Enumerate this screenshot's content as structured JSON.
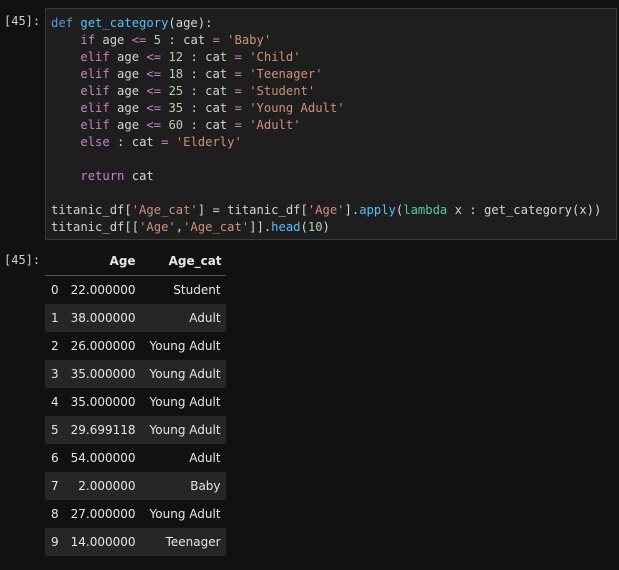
{
  "input_prompt": "[45]:",
  "output_prompt": "[45]:",
  "code": {
    "l1": {
      "def": "def",
      "name": "get_category",
      "args": "(age):"
    },
    "cond_lines": [
      {
        "kw": "if",
        "val": "5",
        "str": "'Baby'"
      },
      {
        "kw": "elif",
        "val": "12",
        "str": "'Child'"
      },
      {
        "kw": "elif",
        "val": "18",
        "str": "'Teenager'"
      },
      {
        "kw": "elif",
        "val": "25",
        "str": "'Student'"
      },
      {
        "kw": "elif",
        "val": "35",
        "str": "'Young Adult'"
      },
      {
        "kw": "elif",
        "val": "60",
        "str": "'Adult'"
      }
    ],
    "else_kw": "else",
    "else_str": "'Elderly'",
    "return_kw": "return",
    "return_val": "cat",
    "assign_line": {
      "a": "titanic_df[",
      "s1": "'Age_cat'",
      "b": "] = titanic_df[",
      "s2": "'Age'",
      "c": "].",
      "apply": "apply",
      "d": "(",
      "lambda": "lambda",
      "e": " x : get_category(x))"
    },
    "head_line": {
      "a": "titanic_df[[",
      "s1": "'Age'",
      "b": ",",
      "s2": "'Age_cat'",
      "c": "]].",
      "head": "head",
      "d": "(",
      "num": "10",
      "e": ")"
    }
  },
  "table": {
    "columns": [
      "",
      "Age",
      "Age_cat"
    ],
    "rows": [
      {
        "idx": "0",
        "age": "22.000000",
        "cat": "Student"
      },
      {
        "idx": "1",
        "age": "38.000000",
        "cat": "Adult"
      },
      {
        "idx": "2",
        "age": "26.000000",
        "cat": "Young Adult"
      },
      {
        "idx": "3",
        "age": "35.000000",
        "cat": "Young Adult"
      },
      {
        "idx": "4",
        "age": "35.000000",
        "cat": "Young Adult"
      },
      {
        "idx": "5",
        "age": "29.699118",
        "cat": "Young Adult"
      },
      {
        "idx": "6",
        "age": "54.000000",
        "cat": "Adult"
      },
      {
        "idx": "7",
        "age": "2.000000",
        "cat": "Baby"
      },
      {
        "idx": "8",
        "age": "27.000000",
        "cat": "Young Adult"
      },
      {
        "idx": "9",
        "age": "14.000000",
        "cat": "Teenager"
      }
    ]
  }
}
